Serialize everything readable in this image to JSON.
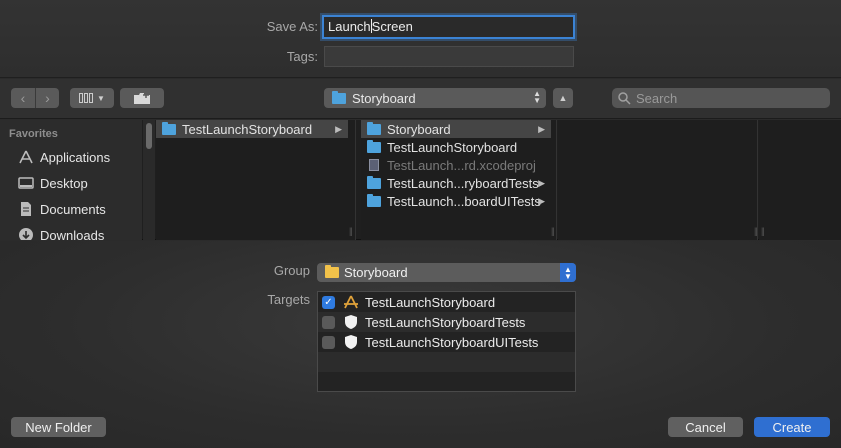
{
  "save_as": {
    "label": "Save As:",
    "value_before_caret": "Launch",
    "value_after_caret": "Screen"
  },
  "tags": {
    "label": "Tags:",
    "value": ""
  },
  "toolbar": {
    "back_icon": "chevron-left-icon",
    "forward_icon": "chevron-right-icon",
    "view_icon": "column-view-icon",
    "new_folder_icon": "folder-plus-icon",
    "location": "Storyboard",
    "expand_icon": "chevron-up-icon",
    "search_placeholder": "Search"
  },
  "sidebar": {
    "heading": "Favorites",
    "items": [
      {
        "label": "Applications",
        "icon": "applications-icon"
      },
      {
        "label": "Desktop",
        "icon": "desktop-icon"
      },
      {
        "label": "Documents",
        "icon": "documents-icon"
      },
      {
        "label": "Downloads",
        "icon": "downloads-icon"
      }
    ]
  },
  "columns": {
    "col1": [
      {
        "label": "TestLaunchStoryboard",
        "selected": true
      }
    ],
    "col2": [
      {
        "label": "Storyboard",
        "selected": true
      },
      {
        "label": "TestLaunchStoryboard"
      },
      {
        "label": "TestLaunch...rd.xcodeproj",
        "dim": true
      },
      {
        "label": "TestLaunch...ryboardTests"
      },
      {
        "label": "TestLaunch...boardUITests"
      }
    ]
  },
  "group": {
    "label": "Group",
    "value": "Storyboard"
  },
  "targets": {
    "label": "Targets",
    "items": [
      {
        "label": "TestLaunchStoryboard",
        "checked": true,
        "icon": "app-target-icon"
      },
      {
        "label": "TestLaunchStoryboardTests",
        "checked": false,
        "icon": "test-shield-icon"
      },
      {
        "label": "TestLaunchStoryboardUITests",
        "checked": false,
        "icon": "test-shield-icon"
      }
    ]
  },
  "buttons": {
    "new_folder": "New Folder",
    "cancel": "Cancel",
    "create": "Create"
  },
  "colors": {
    "accent": "#2f6fd1",
    "folder_blue": "#4ea3dd",
    "folder_yellow": "#f2c24a"
  }
}
